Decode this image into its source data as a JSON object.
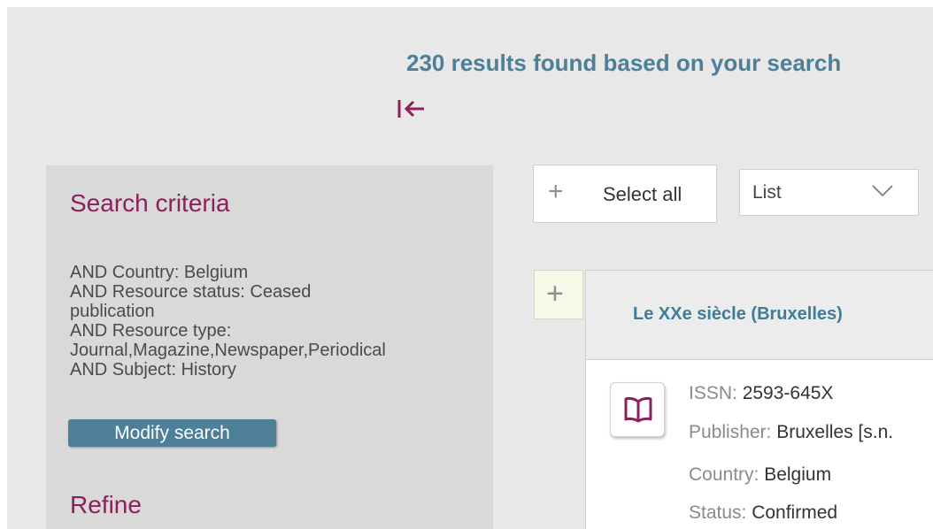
{
  "header": {
    "results_text": "230 results found based on your search"
  },
  "sidebar": {
    "title": "Search criteria",
    "criteria": [
      "AND Country: Belgium",
      "AND Resource status: Ceased",
      "publication",
      "AND Resource type:",
      "Journal,Magazine,Newspaper,Periodical",
      "AND Subject: History"
    ],
    "modify_label": "Modify search",
    "refine_title": "Refine"
  },
  "toolbar": {
    "select_all_label": "Select all",
    "view_value": "List"
  },
  "record": {
    "title": "Le XXe siècle (Bruxelles)",
    "fields": [
      {
        "key": "ISSN: ",
        "value": "2593-645X"
      },
      {
        "key": "Publisher: ",
        "value": "Bruxelles [s.n."
      },
      {
        "key": "Country: ",
        "value": "Belgium"
      },
      {
        "key": "Status: ",
        "value": "Confirmed"
      }
    ]
  },
  "colors": {
    "accent_blue": "#4d7f98",
    "accent_magenta": "#8d1f5b"
  },
  "icons": {
    "collapse": "collapse-left-icon",
    "plus": "plus-icon",
    "chevron": "chevron-down-icon",
    "book": "book-icon"
  }
}
